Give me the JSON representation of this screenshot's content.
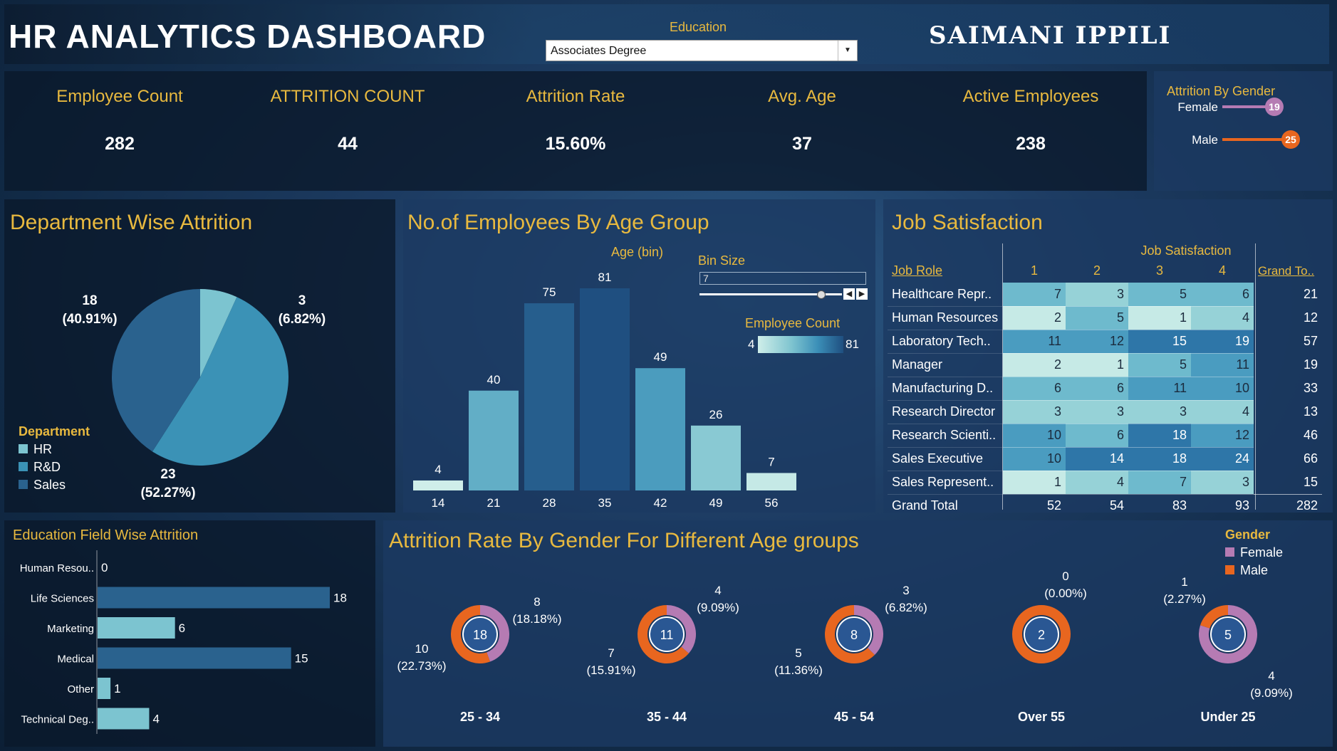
{
  "header": {
    "title": "HR ANALYTICS DASHBOARD",
    "filter_label": "Education",
    "filter_value": "Associates Degree",
    "author": "SAIMANI IPPILI"
  },
  "kpis": [
    {
      "label": "Employee Count",
      "value": "282"
    },
    {
      "label": "ATTRITION COUNT",
      "value": "44"
    },
    {
      "label": "Attrition Rate",
      "value": "15.60%"
    },
    {
      "label": "Avg. Age",
      "value": "37"
    },
    {
      "label": "Active Employees",
      "value": "238"
    }
  ],
  "gender_attrition": {
    "title": "Attrition By Gender",
    "rows": [
      {
        "label": "Female",
        "value": 19,
        "value_text": "19",
        "color": "#b57bb3"
      },
      {
        "label": "Male",
        "value": 25,
        "value_text": "25",
        "color": "#e8661f"
      }
    ]
  },
  "department": {
    "title": "Department Wise Attrition",
    "legend_title": "Department",
    "legend": [
      {
        "label": "HR",
        "color": "#7cc4d0"
      },
      {
        "label": "R&D",
        "color": "#3b92b6"
      },
      {
        "label": "Sales",
        "color": "#2a628e"
      }
    ],
    "labels": [
      {
        "count": "3",
        "pct": "(6.82%)"
      },
      {
        "count": "23",
        "pct": "(52.27%)"
      },
      {
        "count": "18",
        "pct": "(40.91%)"
      }
    ]
  },
  "age_group": {
    "title": "No.of Employees By Age Group",
    "axis_title": "Age (bin)",
    "bin_size_label": "Bin Size",
    "bin_size_value": "7",
    "bin_size_fraction": 0.85,
    "legend_title": "Employee Count",
    "legend_min": "4",
    "legend_max": "81",
    "bar_labels": [
      "4",
      "40",
      "75",
      "81",
      "49",
      "26",
      "7"
    ],
    "tick_labels": [
      "14",
      "21",
      "28",
      "35",
      "42",
      "49",
      "56"
    ]
  },
  "job_satisfaction": {
    "title": "Job Satisfaction",
    "col_header": "Job Satisfaction",
    "row_header": "Job Role",
    "columns": [
      "1",
      "2",
      "3",
      "4"
    ],
    "grand_total_col": "Grand To..",
    "rows": [
      {
        "role": "Healthcare Repr..",
        "values": [
          "7",
          "3",
          "5",
          "6"
        ],
        "total": "21"
      },
      {
        "role": "Human Resources",
        "values": [
          "2",
          "5",
          "1",
          "4"
        ],
        "total": "12"
      },
      {
        "role": "Laboratory Tech..",
        "values": [
          "11",
          "12",
          "15",
          "19"
        ],
        "total": "57"
      },
      {
        "role": "Manager",
        "values": [
          "2",
          "1",
          "5",
          "11"
        ],
        "total": "19"
      },
      {
        "role": "Manufacturing D..",
        "values": [
          "6",
          "6",
          "11",
          "10"
        ],
        "total": "33"
      },
      {
        "role": "Research Director",
        "values": [
          "3",
          "3",
          "3",
          "4"
        ],
        "total": "13"
      },
      {
        "role": "Research Scienti..",
        "values": [
          "10",
          "6",
          "18",
          "12"
        ],
        "total": "46"
      },
      {
        "role": "Sales Executive",
        "values": [
          "10",
          "14",
          "18",
          "24"
        ],
        "total": "66"
      },
      {
        "role": "Sales Represent..",
        "values": [
          "1",
          "4",
          "7",
          "3"
        ],
        "total": "15"
      }
    ],
    "grand_total_row": {
      "role": "Grand Total",
      "values": [
        "52",
        "54",
        "83",
        "93"
      ],
      "total": "282"
    }
  },
  "education_field": {
    "title": "Education Field Wise Attrition"
  },
  "age_gender": {
    "title": "Attrition Rate By Gender For Different Age groups",
    "legend_title": "Gender",
    "legend": [
      {
        "label": "Female",
        "color": "#b57bb3"
      },
      {
        "label": "Male",
        "color": "#e8661f"
      }
    ],
    "groups": [
      {
        "name": "25 - 34",
        "total": "18",
        "female": 8,
        "male": 10,
        "female_text": "8",
        "female_pct": "(18.18%)",
        "male_text": "10",
        "male_pct": "(22.73%)"
      },
      {
        "name": "35 - 44",
        "total": "11",
        "female": 4,
        "male": 7,
        "female_text": "4",
        "female_pct": "(9.09%)",
        "male_text": "7",
        "male_pct": "(15.91%)"
      },
      {
        "name": "45 - 54",
        "total": "8",
        "female": 3,
        "male": 5,
        "female_text": "3",
        "female_pct": "(6.82%)",
        "male_text": "5",
        "male_pct": "(11.36%)"
      },
      {
        "name": "Over 55",
        "total": "2",
        "female": 0,
        "male": 2,
        "female_text": "0",
        "female_pct": "(0.00%)",
        "male_text": "",
        "male_pct": ""
      },
      {
        "name": "Under 25",
        "total": "5",
        "female": 4,
        "male": 1,
        "female_text": "4",
        "female_pct": "(9.09%)",
        "male_text": "1",
        "male_pct": "(2.27%)"
      }
    ]
  },
  "chart_data": [
    {
      "type": "pie",
      "title": "Department Wise Attrition",
      "categories": [
        "HR",
        "R&D",
        "Sales"
      ],
      "values": [
        3,
        23,
        18
      ]
    },
    {
      "type": "bar",
      "title": "No.of Employees By Age Group",
      "xlabel": "Age (bin)",
      "categories": [
        "14",
        "21",
        "28",
        "35",
        "42",
        "49",
        "56"
      ],
      "values": [
        4,
        40,
        75,
        81,
        49,
        26,
        7
      ],
      "ylim": [
        0,
        90
      ]
    },
    {
      "type": "bar",
      "title": "Education Field Wise Attrition",
      "categories": [
        "Human Resou..",
        "Life Sciences",
        "Marketing",
        "Medical",
        "Other",
        "Technical Deg.."
      ],
      "values": [
        0,
        18,
        6,
        15,
        1,
        4
      ],
      "xlim": [
        0,
        20
      ]
    },
    {
      "type": "table",
      "title": "Job Satisfaction",
      "columns": [
        "Job Role",
        "1",
        "2",
        "3",
        "4",
        "Grand To.."
      ],
      "rows": [
        [
          "Healthcare Repr..",
          7,
          3,
          5,
          6,
          21
        ],
        [
          "Human Resources",
          2,
          5,
          1,
          4,
          12
        ],
        [
          "Laboratory Tech..",
          11,
          12,
          15,
          19,
          57
        ],
        [
          "Manager",
          2,
          1,
          5,
          11,
          19
        ],
        [
          "Manufacturing D..",
          6,
          6,
          11,
          10,
          33
        ],
        [
          "Research Director",
          3,
          3,
          3,
          4,
          13
        ],
        [
          "Research Scienti..",
          10,
          6,
          18,
          12,
          46
        ],
        [
          "Sales Executive",
          10,
          14,
          18,
          24,
          66
        ],
        [
          "Sales Represent..",
          1,
          4,
          7,
          3,
          15
        ],
        [
          "Grand Total",
          52,
          54,
          83,
          93,
          282
        ]
      ]
    },
    {
      "type": "pie",
      "title": "Attrition Rate By Gender For Different Age groups",
      "categories": [
        "25 - 34",
        "35 - 44",
        "45 - 54",
        "Over 55",
        "Under 25"
      ],
      "series": [
        {
          "name": "Female",
          "values": [
            8,
            4,
            3,
            0,
            4
          ]
        },
        {
          "name": "Male",
          "values": [
            10,
            7,
            5,
            2,
            1
          ]
        }
      ]
    },
    {
      "type": "bar",
      "title": "Attrition By Gender",
      "categories": [
        "Female",
        "Male"
      ],
      "values": [
        19,
        25
      ]
    }
  ]
}
